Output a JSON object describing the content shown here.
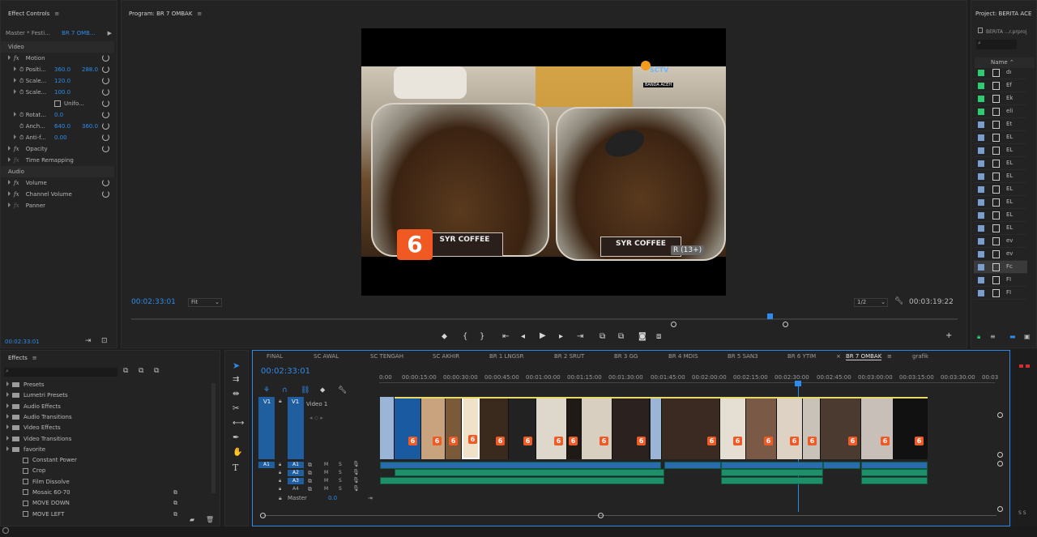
{
  "effect_controls": {
    "title": "Effect Controls",
    "master_label": "Master * Festi...",
    "clip_label": "BR 7 OMB...",
    "video_header": "Video",
    "audio_header": "Audio",
    "motion": "Motion",
    "position_label": "Positi...",
    "position_x": "360.0",
    "position_y": "288.0",
    "scale_label": "Scale...",
    "scale_value": "120.0",
    "scale2_label": "Scale...",
    "scale2_value": "100.0",
    "uniform_label": "Unifo...",
    "rotation_label": "Rotat...",
    "rotation_value": "0.0",
    "anchor_label": "Anch...",
    "anchor_x": "640.0",
    "anchor_y": "360.0",
    "antiflicker_label": "Anti-f...",
    "antiflicker_value": "0.00",
    "opacity": "Opacity",
    "time_remapping": "Time Remapping",
    "volume": "Volume",
    "channel_volume": "Channel Volume",
    "panner": "Panner",
    "timecode": "00:02:33:01"
  },
  "program": {
    "title": "Program: BR 7 OMBAK",
    "timecode": "00:02:33:01",
    "fit": "Fit",
    "resolution": "1/2",
    "duration": "00:03:19:22",
    "overlay_channel": "SCTV",
    "overlay_sub": "BANDA ACEH",
    "logo_number": "6",
    "label_left": "SYR COFFEE",
    "label_right": "SYR COFFEE",
    "rating": "R (13+)",
    "playhead_fraction": 0.77
  },
  "effects": {
    "title": "Effects",
    "items": [
      "Presets",
      "Lumetri Presets",
      "Audio Effects",
      "Audio Transitions",
      "Video Effects",
      "Video Transitions",
      "favorite"
    ],
    "favorites": [
      "Constant Power",
      "Crop",
      "Film Dissolve",
      "Mosaic 60-70",
      "MOVE DOWN",
      "MOVE LEFT"
    ]
  },
  "timeline": {
    "tabs": [
      "FINAL",
      "SC AWAL",
      "SC TENGAH",
      "SC AKHIR",
      "BR 1 LNGSR",
      "BR 2 SRUT",
      "BR 3 GG",
      "BR 4 MDIS",
      "BR 5 SAN3",
      "BR 6 YTIM",
      "BR 7 OMBAK",
      "grafik"
    ],
    "active_tab": "BR 7 OMBAK",
    "timecode": "00:02:33:01",
    "ruler": [
      "0:00",
      "00:00:15:00",
      "00:00:30:00",
      "00:00:45:00",
      "00:01:00:00",
      "00:01:15:00",
      "00:01:30:00",
      "00:01:45:00",
      "00:02:00:00",
      "00:02:15:00",
      "00:02:30:00",
      "00:02:45:00",
      "00:03:00:00",
      "00:03:15:00",
      "00:03:30:00",
      "00:03"
    ],
    "v1_left": "V1",
    "v1_right": "V1",
    "video1": "Video 1",
    "a1_left": "A1",
    "audio_tracks": [
      "A1",
      "A2",
      "A3",
      "A4"
    ],
    "m": "M",
    "s": "S",
    "master": "Master",
    "master_value": "0.0"
  },
  "project": {
    "title": "Project: BERITA ACE",
    "file": "BERITA ...r.prproj",
    "name_col": "Name",
    "items": [
      "dı",
      "Ef",
      "Ek",
      "eli",
      "Et",
      "EL",
      "EL",
      "EL",
      "EL",
      "EL",
      "EL",
      "EL",
      "EL",
      "ev",
      "ev",
      "Fc",
      "FI",
      "FI"
    ],
    "colors": [
      "#2ecc71",
      "#2ecc71",
      "#2ecc71",
      "#2ecc71",
      "#7d9ccf",
      "#7d9ccf",
      "#7d9ccf",
      "#7d9ccf",
      "#7d9ccf",
      "#7d9ccf",
      "#7d9ccf",
      "#7d9ccf",
      "#7d9ccf",
      "#7d9ccf",
      "#7d9ccf",
      "#7d9ccf",
      "#7d9ccf",
      "#7d9ccf"
    ]
  }
}
